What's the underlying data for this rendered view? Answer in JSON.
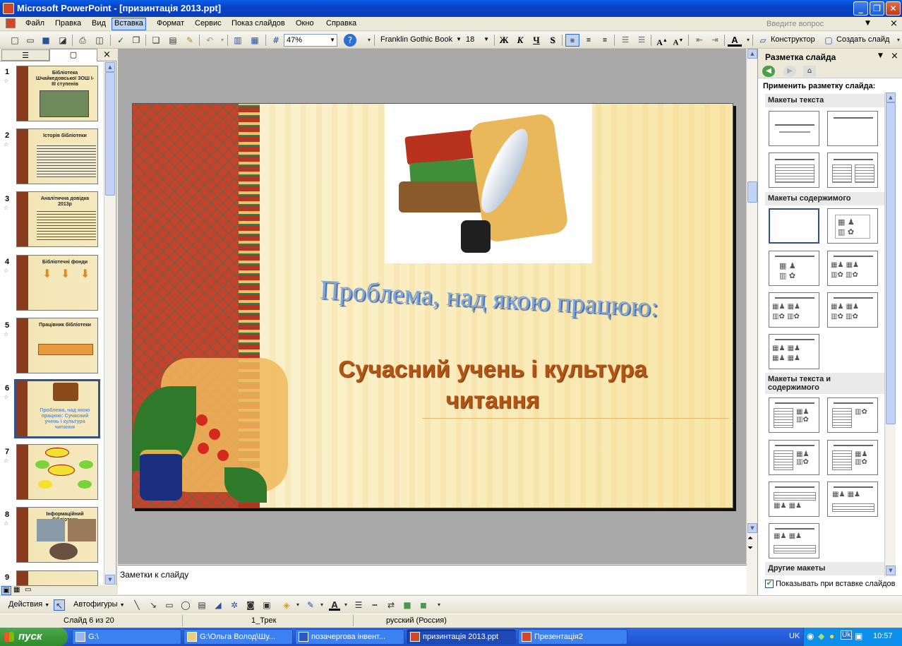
{
  "window": {
    "title": "Microsoft PowerPoint - [призинтація 2013.ppt]",
    "min": "_",
    "restore": "❐",
    "close": "✕"
  },
  "menu": {
    "items": [
      "Файл",
      "Правка",
      "Вид",
      "Вставка",
      "Формат",
      "Сервис",
      "Показ слайдов",
      "Окно",
      "Справка"
    ],
    "active_index": 3,
    "help_placeholder": "Введите вопрос",
    "close": "×"
  },
  "toolbar": {
    "zoom": "47%",
    "font": "Franklin Gothic Book",
    "size": "18",
    "bold": "Ж",
    "italic": "К",
    "underline": "Ч",
    "shadow": "S",
    "designer": "Конструктор",
    "new_slide": "Создать слайд"
  },
  "left_panel": {
    "close": "×",
    "slides": [
      {
        "num": "1",
        "text": "Бібліотека Шчайкедовської ЗОШ І-ІІІ ступенів"
      },
      {
        "num": "2",
        "text": "Історія бібліотеки"
      },
      {
        "num": "3",
        "text": "Аналітична довідка 2013р"
      },
      {
        "num": "4",
        "text": "Бібліотечні фонди"
      },
      {
        "num": "5",
        "text": "Працівник бібліотеки"
      },
      {
        "num": "6",
        "text": "Проблема, над якою працюю: Сучасний учень і культура читання"
      },
      {
        "num": "7",
        "text": ""
      },
      {
        "num": "8",
        "text": "Інформаційний бібліотеки"
      },
      {
        "num": "9",
        "text": ""
      }
    ],
    "selected": "6"
  },
  "slide": {
    "title": "Проблема, над якою працюю:",
    "subtitle_line1": "Сучасний учень і культура",
    "subtitle_line2": "читання"
  },
  "notes": {
    "placeholder": "Заметки к слайду"
  },
  "task_pane": {
    "title": "Разметка слайда",
    "apply_label": "Применить разметку слайда:",
    "sections": [
      "Макеты текста",
      "Макеты содержимого",
      "Макеты текста и содержимого",
      "Другие макеты"
    ],
    "show_on_insert": "Показывать при вставке слайдов",
    "show_on_insert_checked": true
  },
  "draw_toolbar": {
    "actions": "Действия",
    "autoshapes": "Автофигуры"
  },
  "status": {
    "slide": "Слайд 6 из 20",
    "design": "1_Трек",
    "language": "русский (Россия)"
  },
  "taskbar": {
    "start": "пуск",
    "tasks": [
      "G:\\",
      "G:\\Ольга Волод\\Шу...",
      "позачергова інвент...",
      "призинтація 2013.ppt",
      "Презентація2"
    ],
    "active_task": 3,
    "lang": "UK",
    "time": "10:57"
  }
}
